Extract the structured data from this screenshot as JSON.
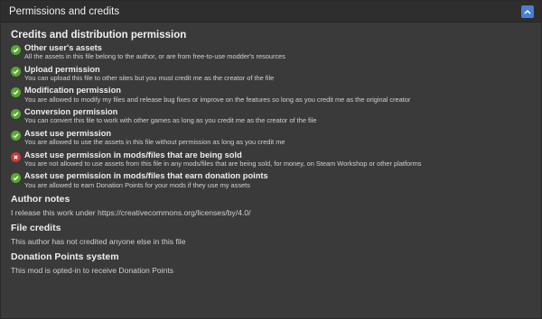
{
  "header": {
    "title": "Permissions and credits"
  },
  "credits": {
    "title": "Credits and distribution permission",
    "items": [
      {
        "status": "allowed",
        "title": "Other user's assets",
        "desc": "All the assets in this file belong to the author, or are from free-to-use modder's resources"
      },
      {
        "status": "allowed",
        "title": "Upload permission",
        "desc": "You can upload this file to other sites but you must credit me as the creator of the file"
      },
      {
        "status": "allowed",
        "title": "Modification permission",
        "desc": "You are allowed to modify my files and release bug fixes or improve on the features so long as you credit me as the original creator"
      },
      {
        "status": "allowed",
        "title": "Conversion permission",
        "desc": "You can convert this file to work with other games as long as you credit me as the creator of the file"
      },
      {
        "status": "allowed",
        "title": "Asset use permission",
        "desc": "You are allowed to use the assets in this file without permission as long as you credit me"
      },
      {
        "status": "denied",
        "title": "Asset use permission in mods/files that are being sold",
        "desc": "You are not allowed to use assets from this file in any mods/files that are being sold, for money, on Steam Workshop or other platforms"
      },
      {
        "status": "allowed",
        "title": "Asset use permission in mods/files that earn donation points",
        "desc": "You are allowed to earn Donation Points for your mods if they use my assets"
      }
    ]
  },
  "author_notes": {
    "title": "Author notes",
    "text": "I release this work under https://creativecommons.org/licenses/by/4.0/"
  },
  "file_credits": {
    "title": "File credits",
    "text": "This author has not credited anyone else in this file"
  },
  "donation": {
    "title": "Donation Points system",
    "text": "This mod is opted-in to receive Donation Points"
  },
  "colors": {
    "allowed": "#5aa732",
    "denied": "#c9393a",
    "accent": "#4a7fd1"
  },
  "icons": {
    "allowed": "checkmark-icon",
    "denied": "cross-icon",
    "collapse": "chevron-up-icon"
  }
}
